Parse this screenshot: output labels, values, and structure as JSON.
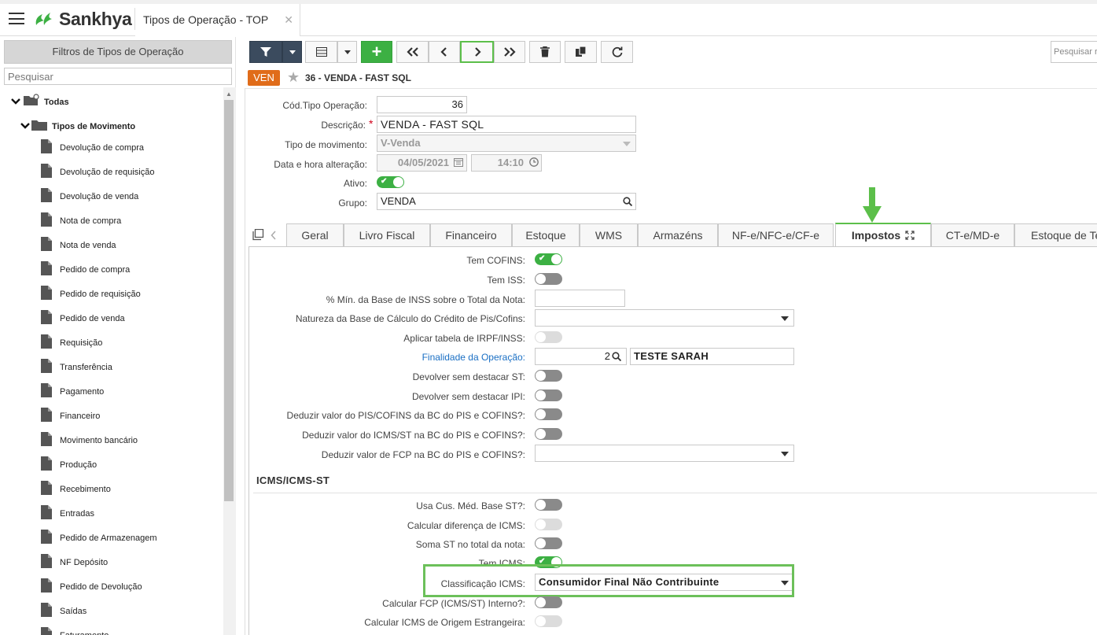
{
  "app": {
    "brand": "Sankhya",
    "tab_title": "Tipos de Operação - TOP",
    "tab_close": "✕"
  },
  "left_panel": {
    "header": "Filtros de Tipos de Operação",
    "search_placeholder": "Pesquisar",
    "root": "Todas",
    "group": "Tipos de Movimento",
    "items": [
      "Devolução de compra",
      "Devolução de requisição",
      "Devolução de venda",
      "Nota de compra",
      "Nota de venda",
      "Pedido de compra",
      "Pedido de requisição",
      "Pedido de venda",
      "Requisição",
      "Transferência",
      "Pagamento",
      "Financeiro",
      "Movimento bancário",
      "Produção",
      "Recebimento",
      "Entradas",
      "Pedido de Armazenagem",
      "NF Depósito",
      "Pedido de Devolução",
      "Saídas",
      "Faturamento"
    ]
  },
  "toolbar": {
    "add_label": "+",
    "search_placeholder": "Pesquisar r"
  },
  "record": {
    "badge": "VEN",
    "title": "36 - VENDA - FAST SQL"
  },
  "form": {
    "cod_label": "Cód.Tipo Operação:",
    "cod_value": "36",
    "desc_label": "Descrição:",
    "desc_required": "*",
    "desc_value": "VENDA - FAST SQL",
    "tipo_label": "Tipo de movimento:",
    "tipo_value": "V-Venda",
    "data_label": "Data e hora alteração:",
    "data_value": "04/05/2021",
    "hora_value": "14:10",
    "ativo_label": "Ativo:",
    "grupo_label": "Grupo:",
    "grupo_value": "VENDA"
  },
  "tabs": [
    "Geral",
    "Livro Fiscal",
    "Financeiro",
    "Estoque",
    "WMS",
    "Armazéns",
    "NF-e/NFC-e/CF-e",
    "Impostos",
    "CT-e/MD-e",
    "Estoque de Te"
  ],
  "active_tab": "Impostos",
  "impostos": {
    "tem_cofins": "Tem COFINS:",
    "tem_iss": "Tem ISS:",
    "min_inss": "% Mín. da Base de INSS sobre o Total da Nota:",
    "natureza": "Natureza da Base de Cálculo do Crédito de Pis/Cofins:",
    "irpf": "Aplicar tabela de IRPF/INSS:",
    "finalidade": "Finalidade da Operação:",
    "finalidade_code": "2",
    "finalidade_desc": "TESTE SARAH",
    "dev_st": "Devolver sem destacar ST:",
    "dev_ipi": "Devolver sem destacar IPI:",
    "ded_pis": "Deduzir valor do PIS/COFINS da BC do PIS e COFINS?:",
    "ded_icms": "Deduzir valor do ICMS/ST na BC do PIS e COFINS?:",
    "ded_fcp": "Deduzir valor de FCP na BC do PIS e COFINS?:",
    "section": "ICMS/ICMS-ST",
    "usa_cus": "Usa Cus. Méd. Base ST?:",
    "calc_dif": "Calcular diferença de ICMS:",
    "soma_st": "Soma ST no total da nota:",
    "tem_icms": "Tem ICMS:",
    "classif": "Classificação ICMS:",
    "classif_value": "Consumidor Final Não Contribuinte",
    "calc_fcp": "Calcular FCP (ICMS/ST) Interno?:",
    "calc_orig": "Calcular ICMS de Origem Estrangeira:"
  },
  "colors": {
    "accent": "#3cb043",
    "badge": "#e06c1a",
    "toolbar_dark": "#3b4b5e",
    "link": "#1a6fc4",
    "highlight": "#6cc05a"
  }
}
